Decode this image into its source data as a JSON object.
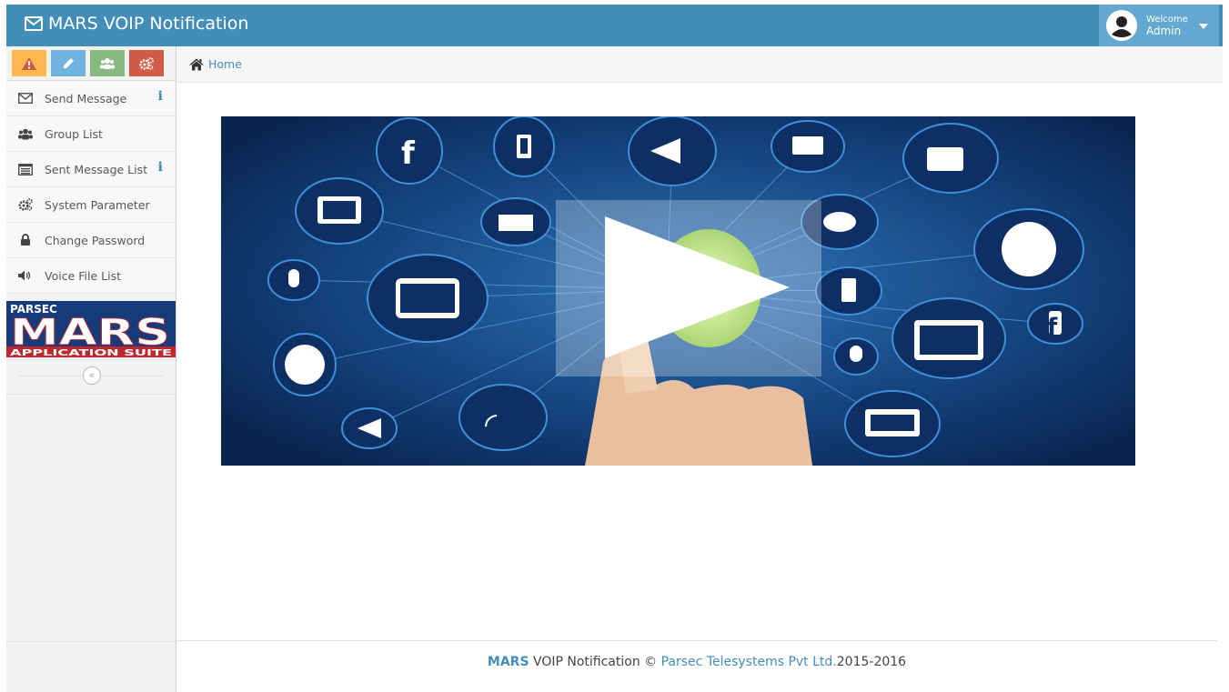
{
  "app": {
    "title": "MARS VOIP Notification"
  },
  "user": {
    "welcome": "Welcome",
    "name": "Admin"
  },
  "shortcuts": [
    {
      "icon": "warning-icon",
      "color": "#ffb752"
    },
    {
      "icon": "pencil-icon",
      "color": "#6fb3e0"
    },
    {
      "icon": "users-icon",
      "color": "#87b87f"
    },
    {
      "icon": "cogs-icon",
      "color": "#d15b47"
    }
  ],
  "sidebar": {
    "items": [
      {
        "label": "Send Message",
        "icon": "envelope-icon",
        "info": "i"
      },
      {
        "label": "Group List",
        "icon": "users-icon"
      },
      {
        "label": "Sent Message List",
        "icon": "list-icon",
        "info": "i"
      },
      {
        "label": "System Parameter",
        "icon": "cogs-icon"
      },
      {
        "label": "Change Password",
        "icon": "lock-icon"
      },
      {
        "label": "Voice File List",
        "icon": "volume-icon"
      }
    ],
    "logo": {
      "line1": "PARSEC",
      "line2": "MARS",
      "line3": "APPLICATION SUITE"
    },
    "collapse_glyph": "«"
  },
  "breadcrumb": {
    "home": "Home"
  },
  "footer": {
    "brand": "MARS",
    "text": " VOIP Notification © ",
    "company": "Parsec Telesystems Pvt Ltd.",
    "years": "2015-2016"
  },
  "colors": {
    "navbar": "#438eb9",
    "user_box": "#62a8d1",
    "link": "#4c8fbd",
    "logo_red": "#c0272d"
  }
}
